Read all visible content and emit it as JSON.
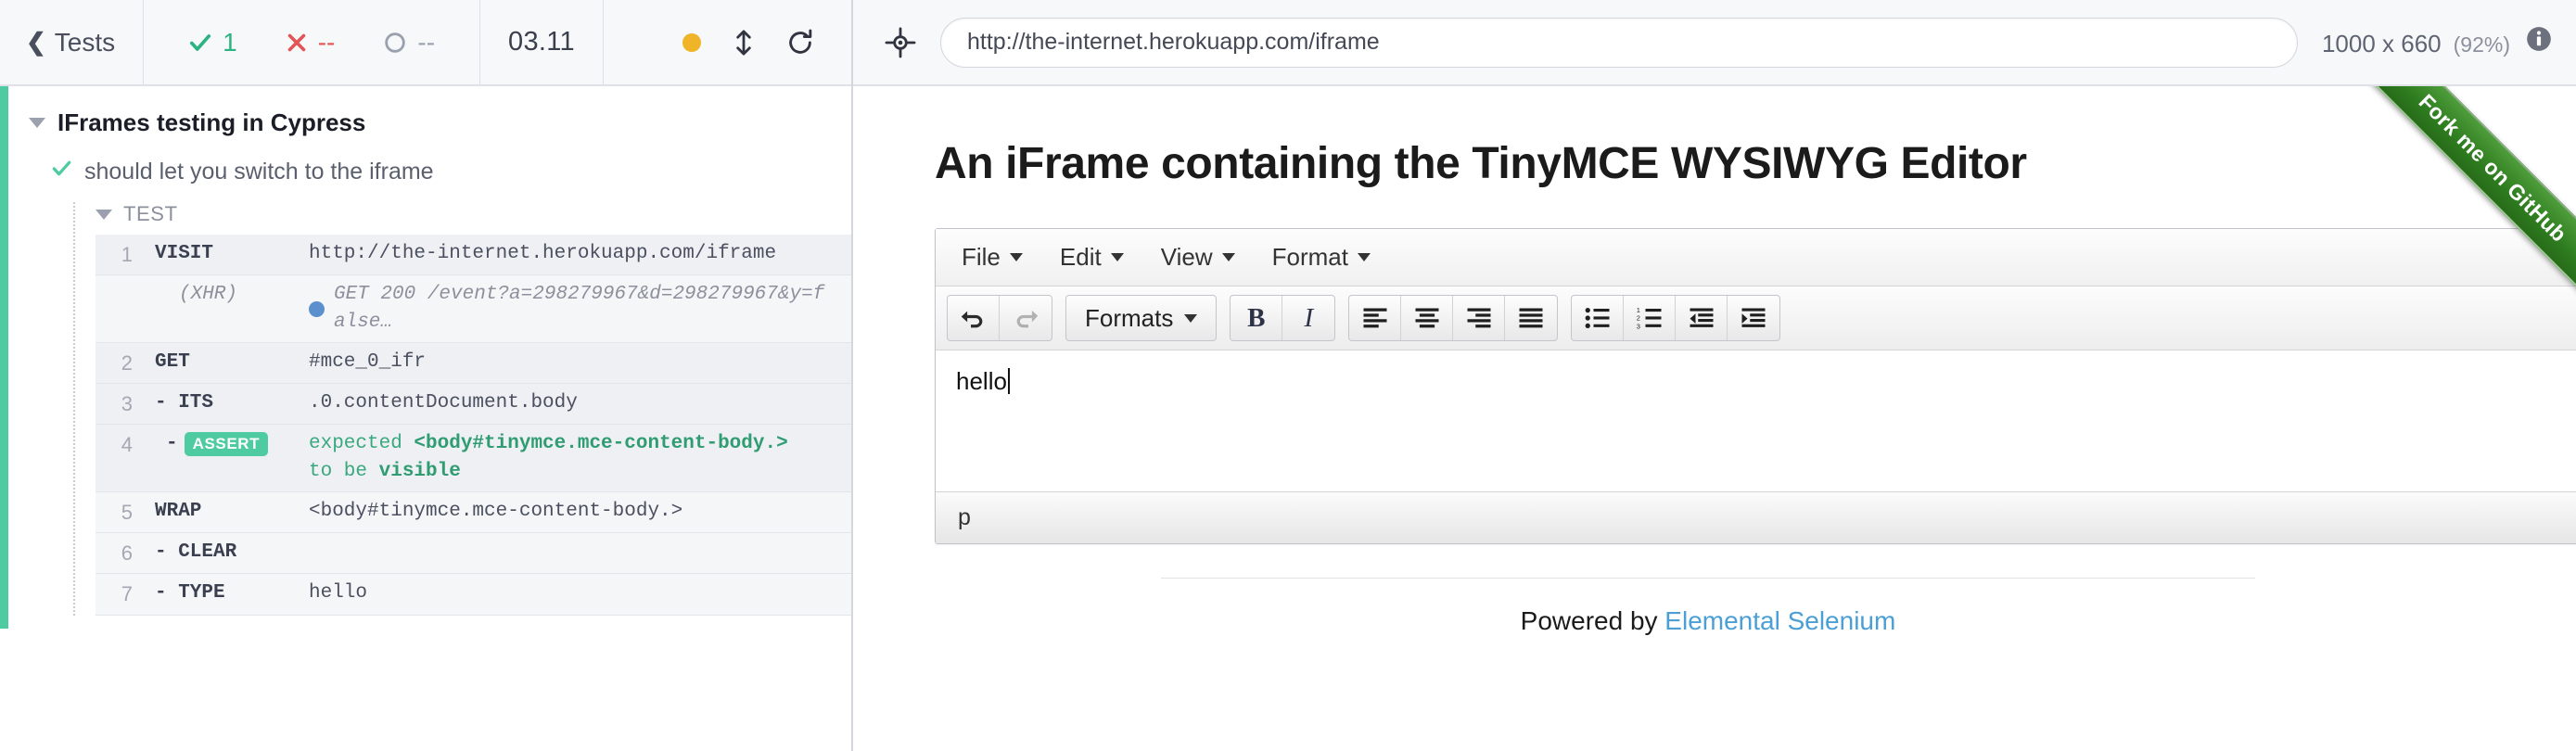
{
  "reporter": {
    "back_label": "Tests",
    "stats": {
      "passed": "1",
      "failed": "--",
      "pending": "--",
      "duration": "03.11"
    },
    "suite": {
      "title": "IFrames testing in Cypress",
      "test": {
        "title": "should let you switch to the iframe",
        "hook_label": "TEST",
        "commands": [
          {
            "num": "1",
            "method": "VISIT",
            "message": "http://the-internet.herokuapp.com/iframe",
            "type": "command"
          },
          {
            "num": "",
            "method": "(XHR)",
            "message": "GET 200 /event?a=298279967&d=298279967&y=false…",
            "type": "xhr"
          },
          {
            "num": "2",
            "method": "GET",
            "message": "#mce_0_ifr",
            "type": "command"
          },
          {
            "num": "3",
            "method": "- ITS",
            "message": ".0.contentDocument.body",
            "type": "command"
          },
          {
            "num": "4",
            "method": "-",
            "badge": "ASSERT",
            "message_pre": "expected ",
            "message_bold": "<body#tinymce.mce-content-body.>",
            "message_mid": "to be ",
            "message_bold2": "visible",
            "type": "assert"
          },
          {
            "num": "5",
            "method": "WRAP",
            "message": "<body#tinymce.mce-content-body.>",
            "type": "command"
          },
          {
            "num": "6",
            "method": "- CLEAR",
            "message": "",
            "type": "command"
          },
          {
            "num": "7",
            "method": "- TYPE",
            "message": "hello",
            "type": "command"
          }
        ]
      }
    },
    "colors": {
      "passed": "#2bb381",
      "failed": "#e45455",
      "pending": "#9aa0ad",
      "suite_bar": "#4ecba0",
      "amber_dot": "#f0b429",
      "xhr_dot": "#5c8fce"
    }
  },
  "aut": {
    "url": "http://the-internet.herokuapp.com/iframe",
    "viewport_size": "1000 x 660",
    "viewport_scale": "(92%)"
  },
  "site": {
    "heading": "An iFrame containing the TinyMCE WYSIWYG Editor",
    "ribbon": "Fork me on GitHub",
    "footer_text": "Powered by ",
    "footer_link": "Elemental Selenium",
    "editor": {
      "menus": [
        "File",
        "Edit",
        "View",
        "Format"
      ],
      "formats_label": "Formats",
      "bold_label": "B",
      "italic_label": "I",
      "content": "hello",
      "status_path": "p"
    }
  }
}
